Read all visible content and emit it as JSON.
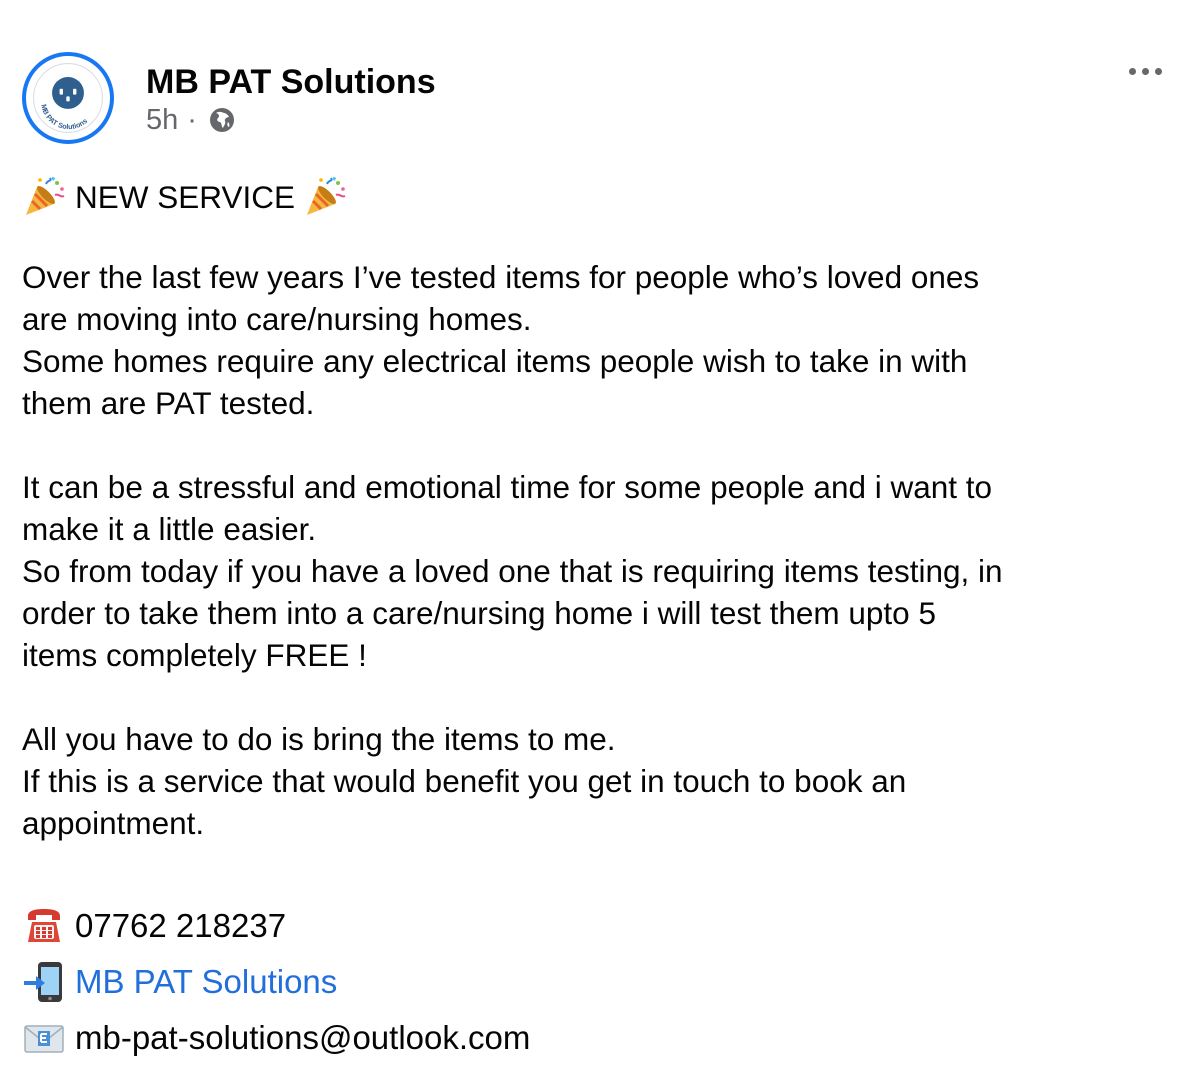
{
  "post": {
    "page_name": "MB PAT Solutions",
    "avatar_text": "MB PAT Solutions",
    "timestamp": "5h",
    "separator": "·",
    "audience_icon": "globe-icon",
    "more_icon": "more-options-icon",
    "headline": "NEW SERVICE",
    "headline_emoji": "party-popper-icon",
    "paragraph1": [
      "Over the last few years I’ve tested items for people who’s loved ones",
      "are moving into care/nursing homes.",
      "Some homes require any electrical items people wish to take in with",
      "them are PAT tested."
    ],
    "paragraph2": [
      "It can be a stressful and emotional time for some people and i want to",
      "make it a little easier.",
      "So from today if you have a loved one that is requiring items testing, in",
      "order to take them into a care/nursing home i will test them upto 5",
      "items completely FREE !"
    ],
    "paragraph3": [
      "All you have to do is bring the items to me.",
      "If this is a service that would benefit you get in touch to book an",
      "appointment."
    ],
    "contacts": {
      "phone": "07762 218237",
      "phone_icon": "telephone-icon",
      "page_link": "MB PAT Solutions",
      "page_link_icon": "mobile-arrow-icon",
      "email": "mb-pat-solutions@outlook.com",
      "email_icon": "envelope-icon"
    }
  },
  "colors": {
    "brand_blue": "#1877f2",
    "link_blue": "#216fdb",
    "text": "#050505",
    "muted": "#65676b"
  }
}
